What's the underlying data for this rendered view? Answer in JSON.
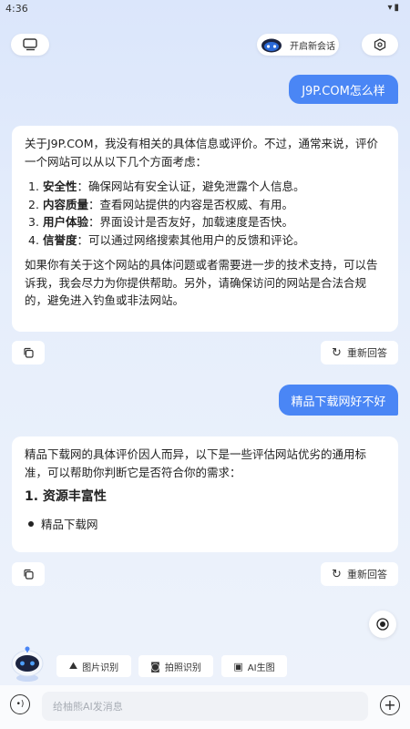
{
  "status": {
    "time": "4:36",
    "icons": [
      "wifi-icon",
      "battery-icon"
    ]
  },
  "header": {
    "new_chat_label": "开启新会话"
  },
  "messages": [
    {
      "role": "user",
      "text": "J9P.COM怎么样"
    },
    {
      "role": "ai",
      "intro": "关于J9P.COM，我没有相关的具体信息或评价。不过，通常来说，评价一个网站可以从以下几个方面考虑：",
      "items": [
        {
          "num": "1.",
          "title": "安全性",
          "text": "：确保网站有安全认证，避免泄露个人信息。"
        },
        {
          "num": "2.",
          "title": "内容质量",
          "text": "：查看网站提供的内容是否权威、有用。"
        },
        {
          "num": "3.",
          "title": "用户体验",
          "text": "：界面设计是否友好，加载速度是否快。"
        },
        {
          "num": "4.",
          "title": "信誉度",
          "text": "：可以通过网络搜索其他用户的反馈和评论。"
        }
      ],
      "outro": "如果你有关于这个网站的具体问题或者需要进一步的技术支持，可以告诉我，我会尽力为你提供帮助。另外，请确保访问的网站是合法合规的，避免进入钓鱼或非法网站。"
    },
    {
      "role": "user",
      "text": "精品下载网好不好"
    },
    {
      "role": "ai",
      "intro": "精品下载网的具体评价因人而异，以下是一些评估网站优劣的通用标准，可以帮助你判断它是否符合你的需求：",
      "section_title": "1. 资源丰富性",
      "bullet": "精品下载网"
    }
  ],
  "actions": {
    "regenerate_label": "重新回答"
  },
  "chips": [
    {
      "label": "图片识别",
      "icon": "image-icon"
    },
    {
      "label": "拍照识别",
      "icon": "camera-icon"
    },
    {
      "label": "AI生图",
      "icon": "picture-icon"
    }
  ],
  "input": {
    "placeholder": "给柚熊AI发消息"
  },
  "colors": {
    "accent": "#4a86f5",
    "background": "#e6eefb"
  }
}
